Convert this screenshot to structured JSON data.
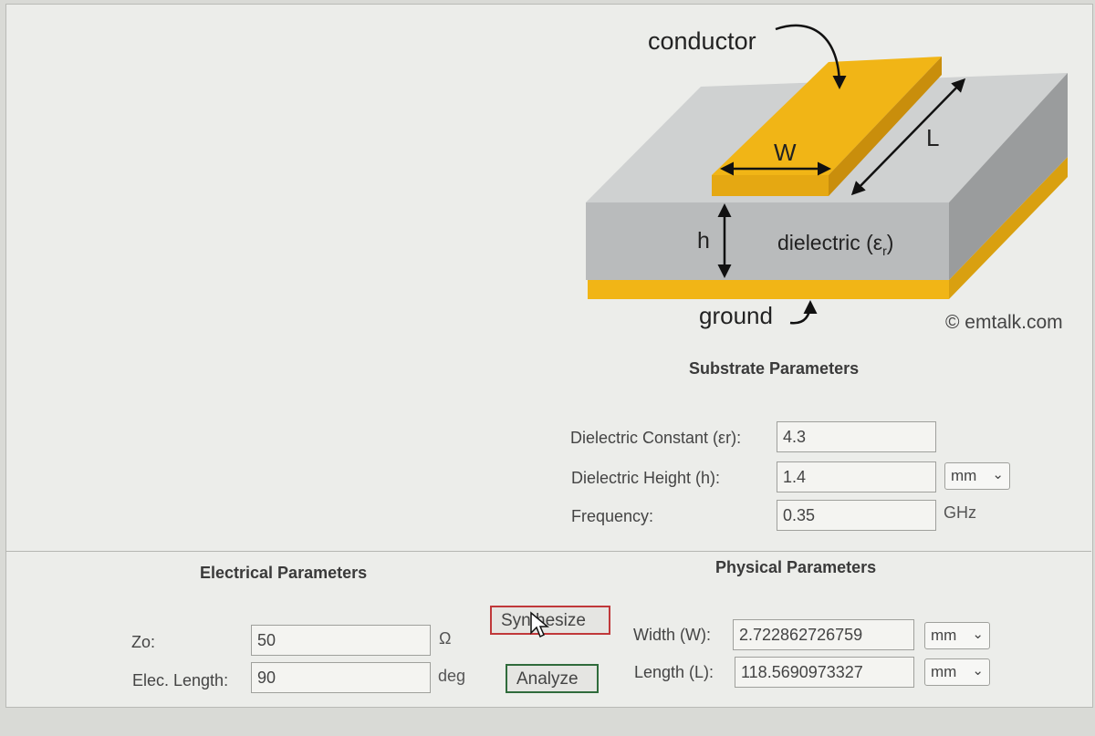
{
  "diagram": {
    "conductor_label": "conductor",
    "width_label": "W",
    "length_label": "L",
    "height_label": "h",
    "dielectric_label": "dielectric (ε",
    "dielectric_sub": "r",
    "dielectric_close": ")",
    "ground_label": "ground",
    "copyright": "© emtalk.com",
    "colors": {
      "conductor": "#f1b516",
      "substrate": "#b9bbbc",
      "ground": "#f1b516"
    }
  },
  "substrate": {
    "title": "Substrate Parameters",
    "dielectric_constant_label": "Dielectric Constant (εr):",
    "dielectric_constant_value": "4.3",
    "dielectric_height_label": "Dielectric Height (h):",
    "dielectric_height_value": "1.4",
    "dielectric_height_unit": "mm",
    "frequency_label": "Frequency:",
    "frequency_value": "0.35",
    "frequency_unit": "GHz"
  },
  "electrical": {
    "title": "Electrical Parameters",
    "zo_label": "Zo:",
    "zo_value": "50",
    "zo_unit": "Ω",
    "elec_length_label": "Elec. Length:",
    "elec_length_value": "90",
    "elec_length_unit": "deg"
  },
  "buttons": {
    "synthesize": "Synthesize",
    "analyze": "Analyze"
  },
  "physical": {
    "title": "Physical Parameters",
    "width_label": "Width (W):",
    "width_value": "2.722862726759",
    "width_unit": "mm",
    "length_label": "Length (L):",
    "length_value": "118.5690973327",
    "length_unit": "mm"
  }
}
